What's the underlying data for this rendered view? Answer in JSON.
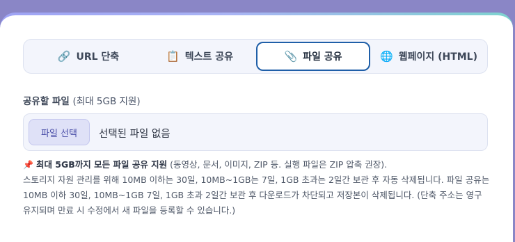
{
  "tabs": [
    {
      "icon": "🔗",
      "label": "URL 단축"
    },
    {
      "icon": "📋",
      "label": "텍스트 공유"
    },
    {
      "icon": "📎",
      "label": "파일 공유"
    },
    {
      "icon": "🌐",
      "label": "웹페이지 (HTML)"
    }
  ],
  "active_tab_index": 2,
  "file_field": {
    "label": "공유할 파일",
    "label_sub": "(최대 5GB 지원)",
    "button_label": "파일 선택",
    "no_file_text": "선택된 파일 없음"
  },
  "notes": {
    "pin_icon": "📌",
    "highlight": "최대 5GB까지 모든 파일 공유 지원",
    "line1_rest": " (동영상, 문서, 이미지, ZIP 등. 실행 파일은 ZIP 압축 권장).",
    "line2": "스토리지 자원 관리를 위해 10MB 이하는 30일, 10MB~1GB는 7일, 1GB 초과는 2일간 보관 후 자동 삭제됩니다. 파일 공유는 10MB 이하 30일, 10MB~1GB 7일, 1GB 초과 2일간 보관 후 다운로드가 차단되고 저장본이 삭제됩니다. (단축 주소는 영구 유지되며 만료 시 수정에서 새 파일을 등록할 수 있습니다.)"
  },
  "colors": {
    "active_tab_border": "#1f5fa8",
    "file_button_bg": "#dfe1f7",
    "card_top_gradient": [
      "#9ea3f4",
      "#7ed3cf"
    ]
  }
}
